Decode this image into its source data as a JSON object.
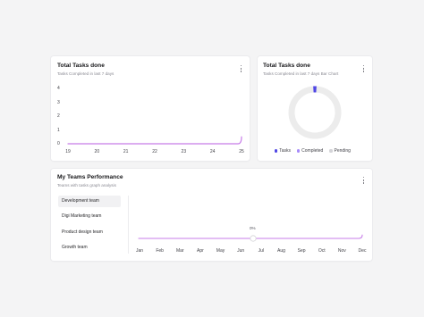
{
  "colors": {
    "line": "#c77ce8",
    "tasks": "#4f46e5",
    "completed": "#a78bfa",
    "pending": "#d4d4d8",
    "ring": "#ececec"
  },
  "tasks_card": {
    "title": "Total Tasks done",
    "subtitle": "Tasks Completed in last 7 days",
    "menu_icon": "more-vertical-icon"
  },
  "donut_card": {
    "title": "Total Tasks done",
    "subtitle": "Tasks Completed in last 7 days Bar Chart",
    "legend": [
      "Tasks",
      "Completed",
      "Pending"
    ],
    "menu_icon": "more-vertical-icon"
  },
  "teams_card": {
    "title": "My Teams Performance",
    "subtitle": "Teams with tasks graph analysis",
    "teams": [
      "Development team",
      "Digi Marketing team",
      "Product design team",
      "Growth team"
    ],
    "selected_team": "Development team",
    "tooltip": "0%",
    "menu_icon": "more-vertical-icon"
  },
  "chart_data": [
    {
      "type": "line",
      "x": [
        "19",
        "20",
        "21",
        "22",
        "23",
        "24",
        "25"
      ],
      "y_ticks": [
        "4",
        "3",
        "2",
        "1",
        "0"
      ],
      "ylim": [
        0,
        4
      ],
      "series": [
        {
          "values": [
            0,
            0,
            0,
            0,
            0,
            0,
            0.5
          ]
        }
      ]
    },
    {
      "type": "pie",
      "series": [
        {
          "name": "Tasks",
          "values": [
            1
          ]
        },
        {
          "name": "Completed",
          "values": [
            0
          ]
        },
        {
          "name": "Pending",
          "values": [
            0
          ]
        }
      ]
    },
    {
      "type": "line",
      "x": [
        "Jan",
        "Feb",
        "Mar",
        "Apr",
        "May",
        "Jun",
        "Jul",
        "Aug",
        "Sep",
        "Oct",
        "Nov",
        "Dec"
      ],
      "ylim": [
        0,
        100
      ],
      "series": [
        {
          "values": [
            0,
            0,
            0,
            0,
            0,
            0,
            0,
            0,
            0,
            0,
            0,
            8
          ]
        }
      ]
    }
  ]
}
